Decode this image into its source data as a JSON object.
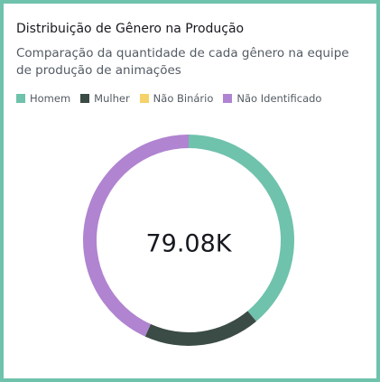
{
  "card": {
    "border_color": "#6fc2ac"
  },
  "chart_data": {
    "type": "pie",
    "variant": "donut",
    "title": "Distribuição de Gênero na Produção",
    "subtitle": "Comparação da quantidade de cada gênero na equipe de produção de animações",
    "center_label": "79.08K",
    "legend_position": "top-left",
    "categories": [
      "Homem",
      "Mulher",
      "Não Binário",
      "Não Identificado"
    ],
    "values": [
      30.8,
      14.1,
      0.0,
      34.2
    ],
    "colors": [
      "#6fc2ac",
      "#3b4b45",
      "#f5d26a",
      "#b084d0"
    ]
  }
}
